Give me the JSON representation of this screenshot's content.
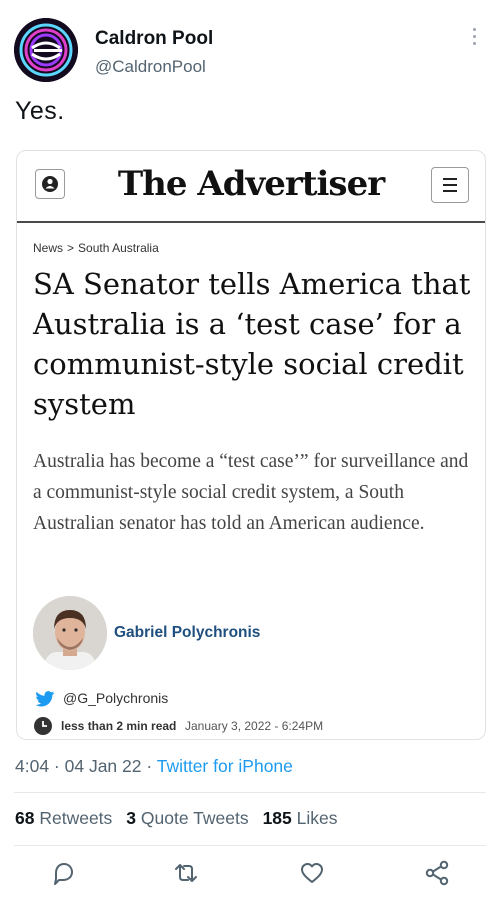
{
  "tweet": {
    "author_name": "Caldron Pool",
    "author_handle": "@CaldronPool",
    "text": "Yes.",
    "timestamp": "4:04 · 04 Jan 22 · ",
    "source": "Twitter for iPhone"
  },
  "card": {
    "masthead": "The Advertiser",
    "breadcrumb": [
      "News",
      ">",
      "South Australia"
    ],
    "headline": "SA Senator tells America that Australia is a ‘test case’ for a communist-style social credit system",
    "standfirst": "Australia has become a “test case’” for surveillance and a communist-style social credit system, a South Australian senator has told an American audience.",
    "author": "Gabriel Polychronis",
    "author_twitter": "@G_Polychronis",
    "read_time": "less than 2 min read",
    "date": "January 3, 2022 - 6:24PM"
  },
  "stats": {
    "retweets_count": "68",
    "retweets_label": "Retweets",
    "quotes_count": "3",
    "quotes_label": "Quote Tweets",
    "likes_count": "185",
    "likes_label": "Likes"
  },
  "colors": {
    "link_blue": "#1d9bf0",
    "author_blue": "#1e4f7e",
    "secondary_text": "#536471"
  }
}
